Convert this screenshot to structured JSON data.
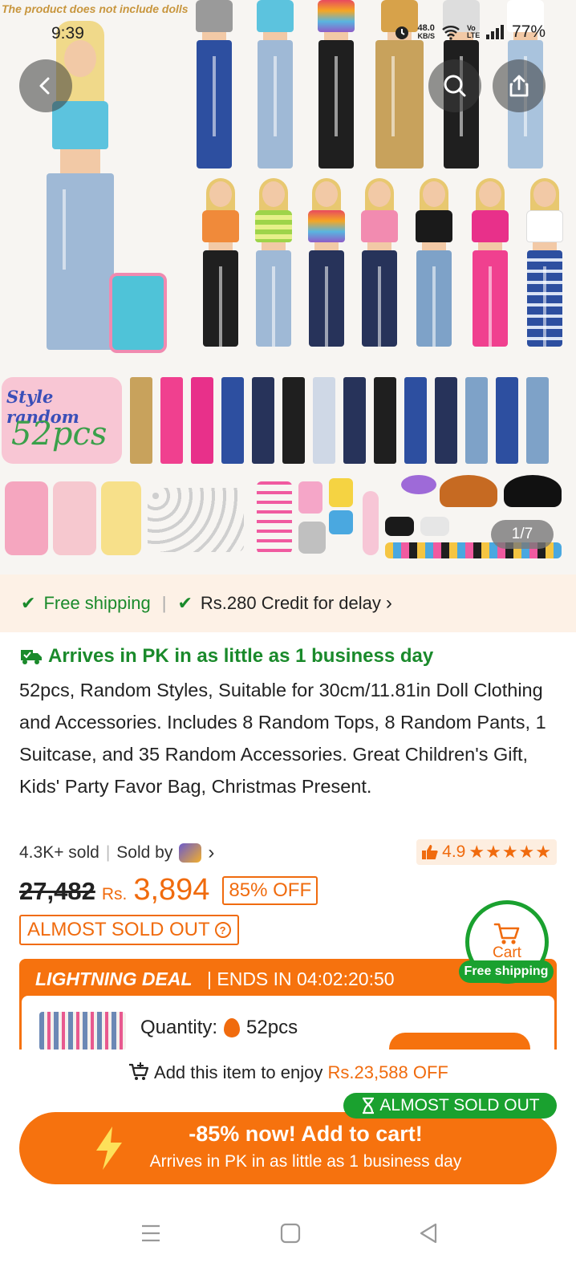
{
  "hero": {
    "disclaimer": "The product does not include dolls",
    "badge_line1": "Style random",
    "badge_line2": "52pcs",
    "image_counter": "1/7"
  },
  "status_bar": {
    "time": "9:39",
    "net_speed": "48.0",
    "net_unit": "KB/S",
    "volte": "Vo LTE",
    "battery": "77%"
  },
  "header": {
    "back_icon": "chevron-left-icon",
    "search_icon": "search-icon",
    "share_icon": "share-icon"
  },
  "shipping": {
    "free_shipping": "Free shipping",
    "credit": "Rs.280 Credit for delay",
    "credit_chevron": "›"
  },
  "product": {
    "arrival": "Arrives in PK in as little as 1 business day",
    "title": "52pcs, Random Styles, Suitable for 30cm/11.81in Doll Clothing and Accessories. Includes 8 Random Tops, 8 Random Pants, 1 Suitcase, and 35 Random Accessories. Great Children's Gift, Kids' Party Favor Bag, Christmas Present.",
    "sold": "4.3K+ sold",
    "sold_by": "Sold by",
    "rating": "4.9",
    "stars": "★★★★★"
  },
  "price": {
    "old": "27,482",
    "currency": "Rs.",
    "current": "3,894",
    "discount": "85% OFF",
    "almost_sold_out": "ALMOST SOLD OUT"
  },
  "deal": {
    "title": "LIGHTNING DEAL",
    "ends": "| ENDS IN 04:02:20:50",
    "quantity_label": "Quantity:",
    "quantity_value": "52pcs"
  },
  "cart_float": {
    "label": "Cart",
    "free_shipping": "Free shipping"
  },
  "bottom": {
    "enjoy_prefix": "Add this item to enjoy",
    "enjoy_amount": "Rs.23,588 OFF",
    "sold_out_tag": "ALMOST SOLD OUT",
    "cta_line1": "-85% now! Add to cart!",
    "cta_line2": "Arrives in PK in as little as 1 business day"
  },
  "colors": {
    "accent_orange": "#f6720e",
    "green": "#1aa12f",
    "strip_bg": "#fdf1e6"
  }
}
